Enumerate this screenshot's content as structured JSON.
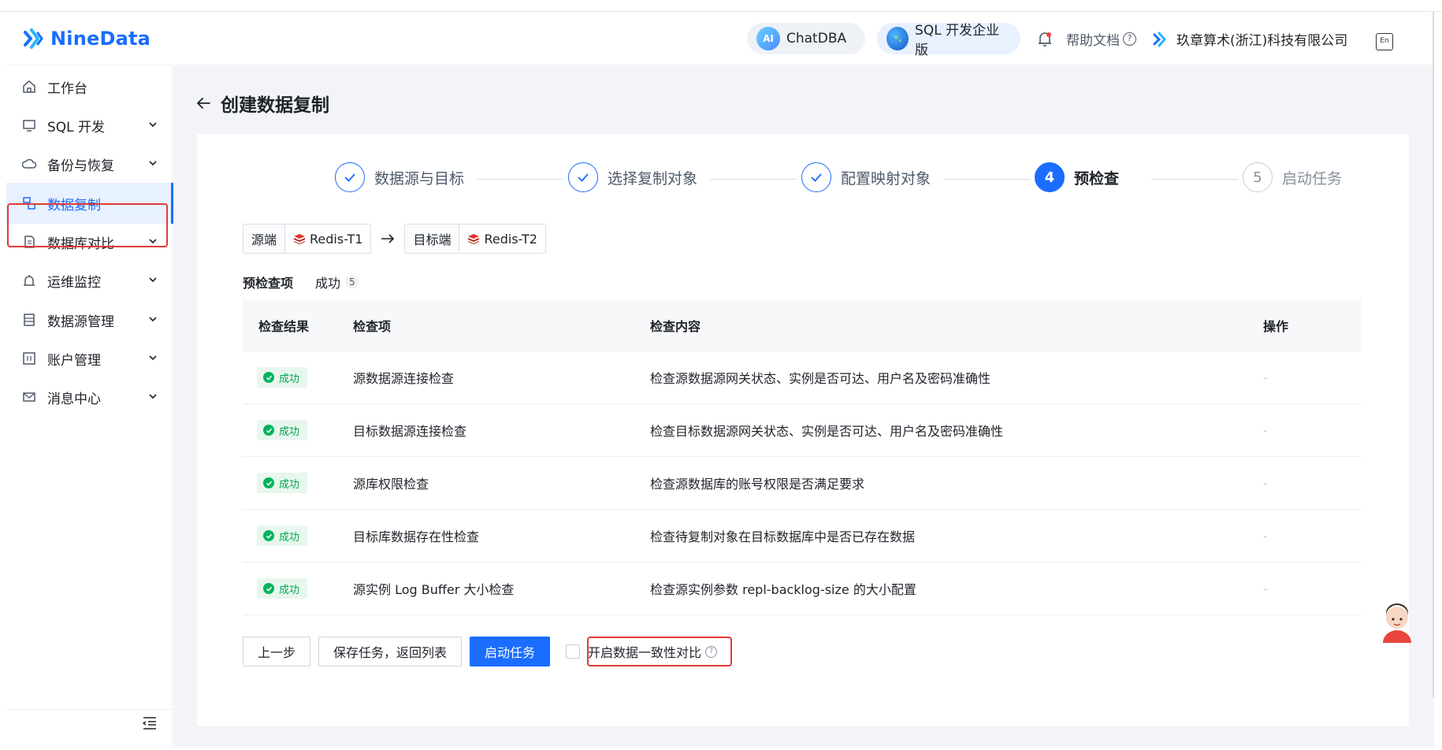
{
  "header": {
    "brand": "NineData",
    "chatdba": "ChatDBA",
    "sql_edition": "SQL 开发企业版",
    "help": "帮助文档",
    "org": "玖章算术(浙江)科技有限公司",
    "ai_badge": "AI",
    "lang_badge": "En"
  },
  "sidebar": {
    "items": [
      {
        "label": "工作台",
        "icon": "home-icon"
      },
      {
        "label": "SQL 开发",
        "icon": "monitor-icon"
      },
      {
        "label": "备份与恢复",
        "icon": "cloud-icon"
      },
      {
        "label": "数据复制",
        "icon": "replication-icon"
      },
      {
        "label": "数据库对比",
        "icon": "compare-icon"
      },
      {
        "label": "运维监控",
        "icon": "alarm-icon"
      },
      {
        "label": "数据源管理",
        "icon": "database-icon"
      },
      {
        "label": "账户管理",
        "icon": "account-icon"
      },
      {
        "label": "消息中心",
        "icon": "mail-icon"
      }
    ]
  },
  "page": {
    "title": "创建数据复制"
  },
  "steps": [
    {
      "num": "1",
      "label": "数据源与目标",
      "state": "done"
    },
    {
      "num": "2",
      "label": "选择复制对象",
      "state": "done"
    },
    {
      "num": "3",
      "label": "配置映射对象",
      "state": "done"
    },
    {
      "num": "4",
      "label": "预检查",
      "state": "current"
    },
    {
      "num": "5",
      "label": "启动任务",
      "state": "pending"
    }
  ],
  "source_target": {
    "source_label": "源端",
    "source_value": "Redis-T1",
    "target_label": "目标端",
    "target_value": "Redis-T2"
  },
  "precheck": {
    "title": "预检查项",
    "success_label": "成功",
    "success_count": "5"
  },
  "table": {
    "headers": [
      "检查结果",
      "检查项",
      "检查内容",
      "操作"
    ],
    "rows": [
      {
        "result": "成功",
        "item": "源数据源连接检查",
        "content": "检查源数据源网关状态、实例是否可达、用户名及密码准确性",
        "op": "-"
      },
      {
        "result": "成功",
        "item": "目标数据源连接检查",
        "content": "检查目标数据源网关状态、实例是否可达、用户名及密码准确性",
        "op": "-"
      },
      {
        "result": "成功",
        "item": "源库权限检查",
        "content": "检查源数据库的账号权限是否满足要求",
        "op": "-"
      },
      {
        "result": "成功",
        "item": "目标库数据存在性检查",
        "content": "检查待复制对象在目标数据库中是否已存在数据",
        "op": "-"
      },
      {
        "result": "成功",
        "item": "源实例 Log Buffer 大小检查",
        "content": "检查源实例参数 repl-backlog-size 的大小配置",
        "op": "-"
      }
    ]
  },
  "actions": {
    "prev": "上一步",
    "save": "保存任务，返回列表",
    "start": "启动任务",
    "compare": "开启数据一致性对比"
  },
  "colors": {
    "accent": "#1a6dff",
    "success": "#00b35e",
    "highlight": "#e23a3a"
  }
}
